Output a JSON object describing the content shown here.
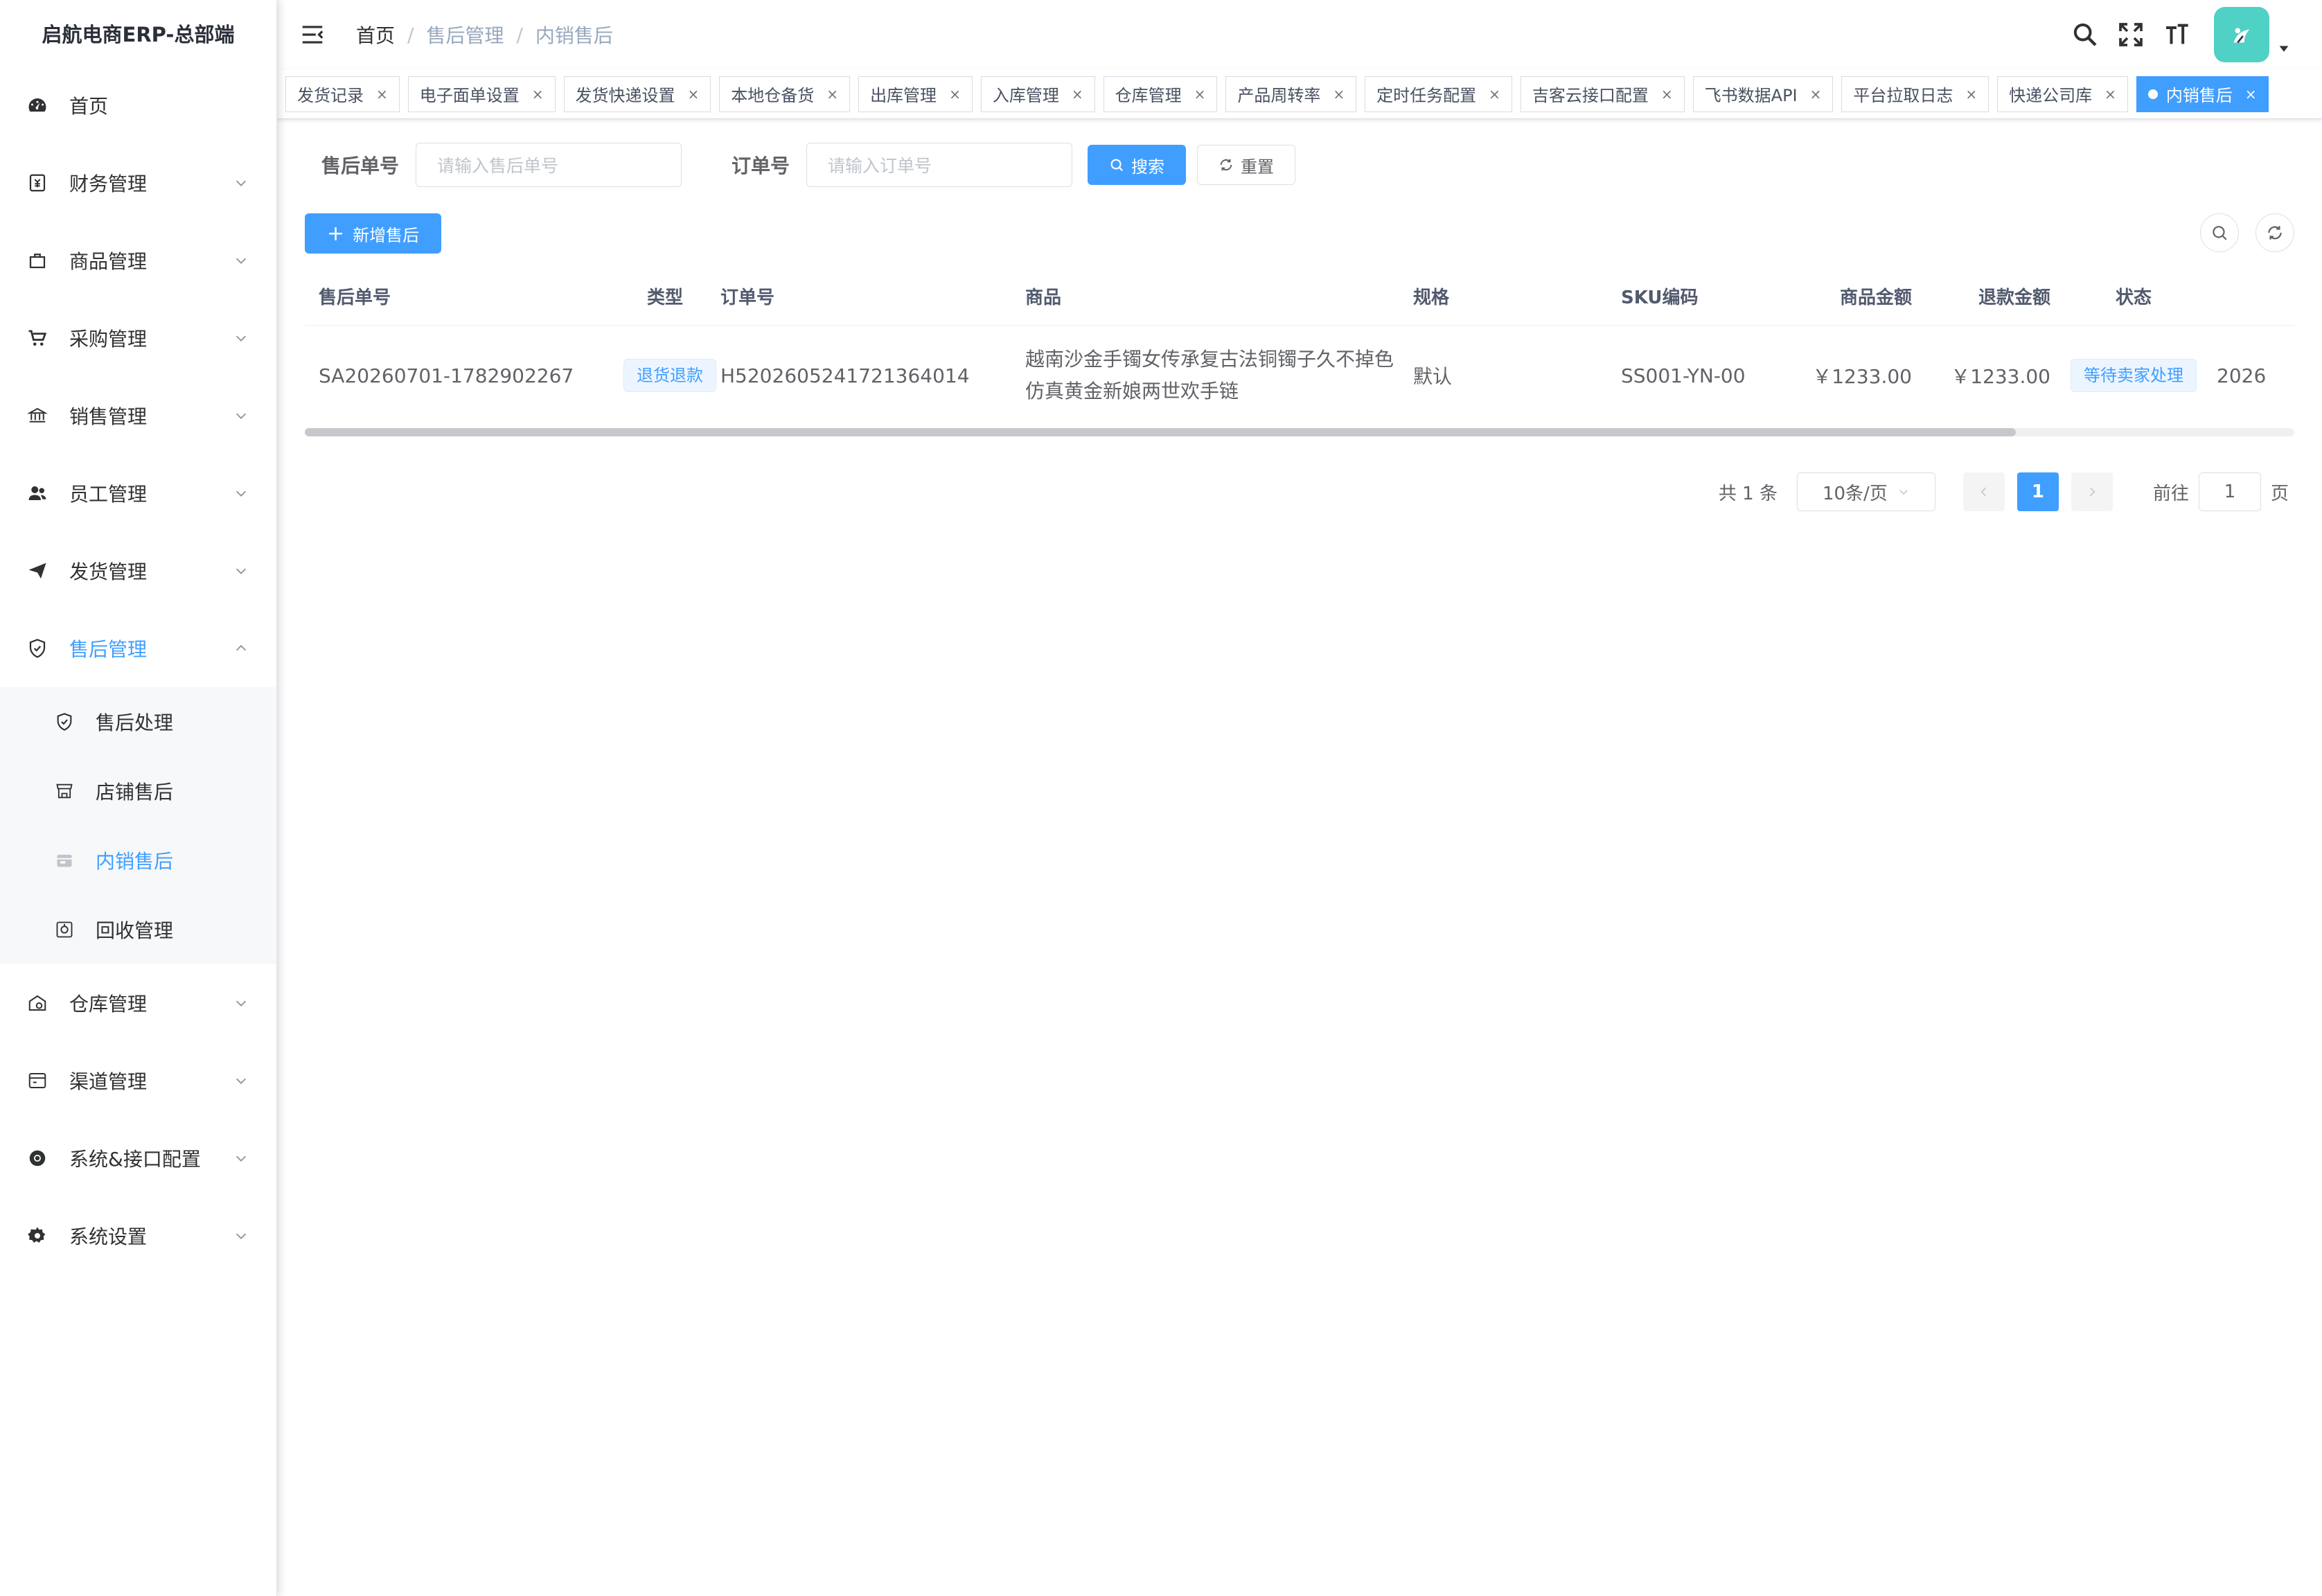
{
  "app": {
    "title": "启航电商ERP-总部端"
  },
  "sidebar": {
    "items": [
      {
        "label": "首页",
        "icon": "dashboard-icon"
      },
      {
        "label": "财务管理",
        "icon": "finance-icon"
      },
      {
        "label": "商品管理",
        "icon": "goods-icon"
      },
      {
        "label": "采购管理",
        "icon": "cart-icon"
      },
      {
        "label": "销售管理",
        "icon": "bank-icon"
      },
      {
        "label": "员工管理",
        "icon": "peoples-icon"
      },
      {
        "label": "发货管理",
        "icon": "send-icon"
      },
      {
        "label": "售后管理",
        "icon": "shield-icon"
      },
      {
        "label": "仓库管理",
        "icon": "warehouse-icon"
      },
      {
        "label": "渠道管理",
        "icon": "channel-icon"
      },
      {
        "label": "系统&接口配置",
        "icon": "chrome-icon"
      },
      {
        "label": "系统设置",
        "icon": "gear-icon"
      }
    ],
    "aftersale_sub": [
      {
        "label": "售后处理",
        "icon": "shield-check-icon"
      },
      {
        "label": "店铺售后",
        "icon": "shop-icon"
      },
      {
        "label": "内销售后",
        "icon": "store-icon"
      },
      {
        "label": "回收管理",
        "icon": "recycle-icon"
      }
    ]
  },
  "header": {
    "breadcrumb": [
      "首页",
      "售后管理",
      "内销售后"
    ],
    "separator": "/"
  },
  "tags": [
    "发货记录",
    "电子面单设置",
    "发货快递设置",
    "本地仓备货",
    "出库管理",
    "入库管理",
    "仓库管理",
    "产品周转率",
    "定时任务配置",
    "吉客云接口配置",
    "飞书数据API",
    "平台拉取日志",
    "快递公司库",
    "内销售后"
  ],
  "tag_close": "×",
  "search": {
    "aftersale_no_label": "售后单号",
    "aftersale_no_placeholder": "请输入售后单号",
    "order_no_label": "订单号",
    "order_no_placeholder": "请输入订单号",
    "search_label": "搜索",
    "reset_label": "重置"
  },
  "toolbar": {
    "add_label": "新增售后",
    "add_plus": "+"
  },
  "table": {
    "columns": [
      "售后单号",
      "类型",
      "订单号",
      "商品",
      "规格",
      "SKU编码",
      "商品金额",
      "退款金额",
      "状态"
    ],
    "rows": [
      {
        "aftersale_no": "SA20260701-1782902267",
        "type": "退货退款",
        "order_no": "H5202605241721364014",
        "product": "越南沙金手镯女传承复古法铜镯子久不掉色仿真黄金新娘两世欢手链",
        "spec": "默认",
        "sku": "SS001-YN-00",
        "goods_amount": "￥1233.00",
        "refund_amount": "￥1233.00",
        "status": "等待卖家处理",
        "overflow": "2026"
      }
    ]
  },
  "pagination": {
    "total": "共 1 条",
    "page_size": "10条/页",
    "current": "1",
    "goto_label": "前往",
    "goto_value": "1",
    "page_suffix": "页"
  },
  "colors": {
    "primary": "#409eff",
    "text": "#303133",
    "muted": "#97a8be"
  }
}
